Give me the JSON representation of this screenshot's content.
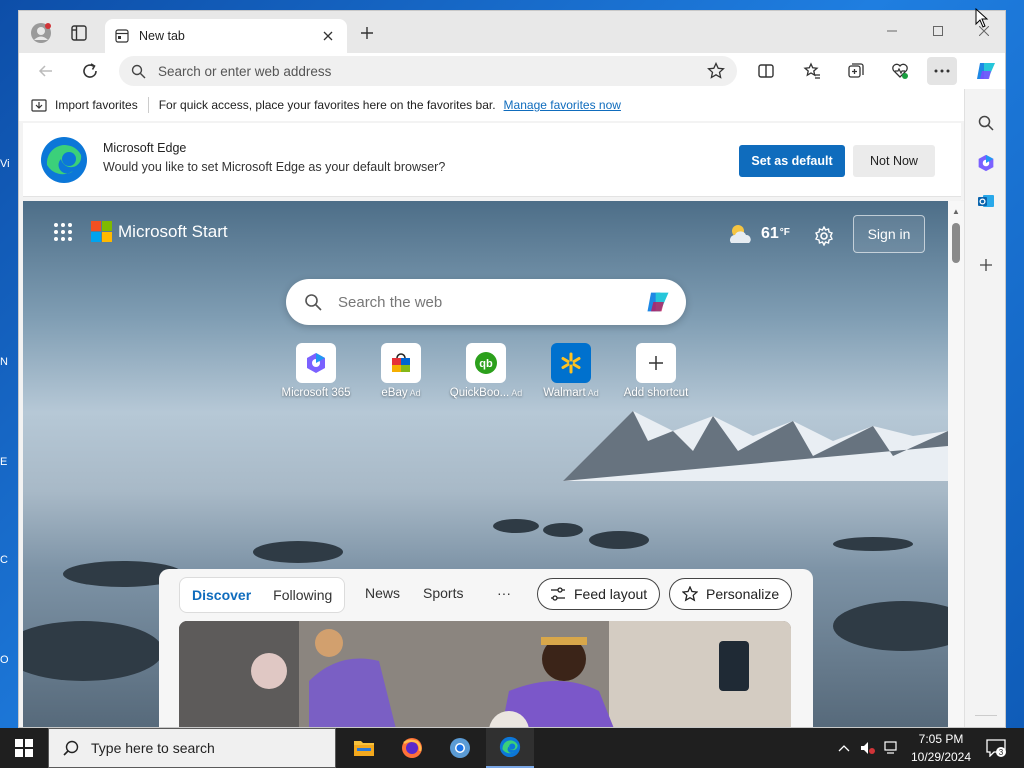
{
  "desktop": {
    "fragments": [
      "Vi",
      "N",
      "E",
      "C",
      "O"
    ]
  },
  "browser": {
    "tab": {
      "title": "New tab"
    },
    "window_controls": [
      "minimize",
      "maximize",
      "close"
    ],
    "address_bar": {
      "placeholder": "Search or enter web address"
    },
    "favorites_bar": {
      "import_label": "Import favorites",
      "message": "For quick access, place your favorites here on the favorites bar.",
      "manage_link": "Manage favorites now"
    },
    "banner": {
      "title": "Microsoft Edge",
      "text": "Would you like to set Microsoft Edge as your default browser?",
      "primary_button": "Set as default",
      "secondary_button": "Not Now"
    }
  },
  "start_page": {
    "brand": "Microsoft Start",
    "weather": {
      "temp": "61",
      "unit": "°F"
    },
    "sign_in": "Sign in",
    "search": {
      "placeholder": "Search the web"
    },
    "shortcuts": [
      {
        "label": "Microsoft 365",
        "ad": ""
      },
      {
        "label": "eBay",
        "ad": "Ad"
      },
      {
        "label": "QuickBoo...",
        "ad": "Ad"
      },
      {
        "label": "Walmart",
        "ad": "Ad"
      },
      {
        "label": "Add shortcut",
        "ad": ""
      }
    ],
    "feed": {
      "tabs": [
        "Discover",
        "Following"
      ],
      "active_tab": "Discover",
      "extra_tabs": [
        "News",
        "Sports"
      ],
      "more": "···",
      "feed_layout": "Feed layout",
      "personalize": "Personalize"
    }
  },
  "taskbar": {
    "search_placeholder": "Type here to search",
    "clock": {
      "time": "7:05 PM",
      "date": "10/29/2024"
    },
    "notifications_count": "3"
  },
  "colors": {
    "accent": "#0f6cbd",
    "taskbar": "#1f1f1f"
  }
}
